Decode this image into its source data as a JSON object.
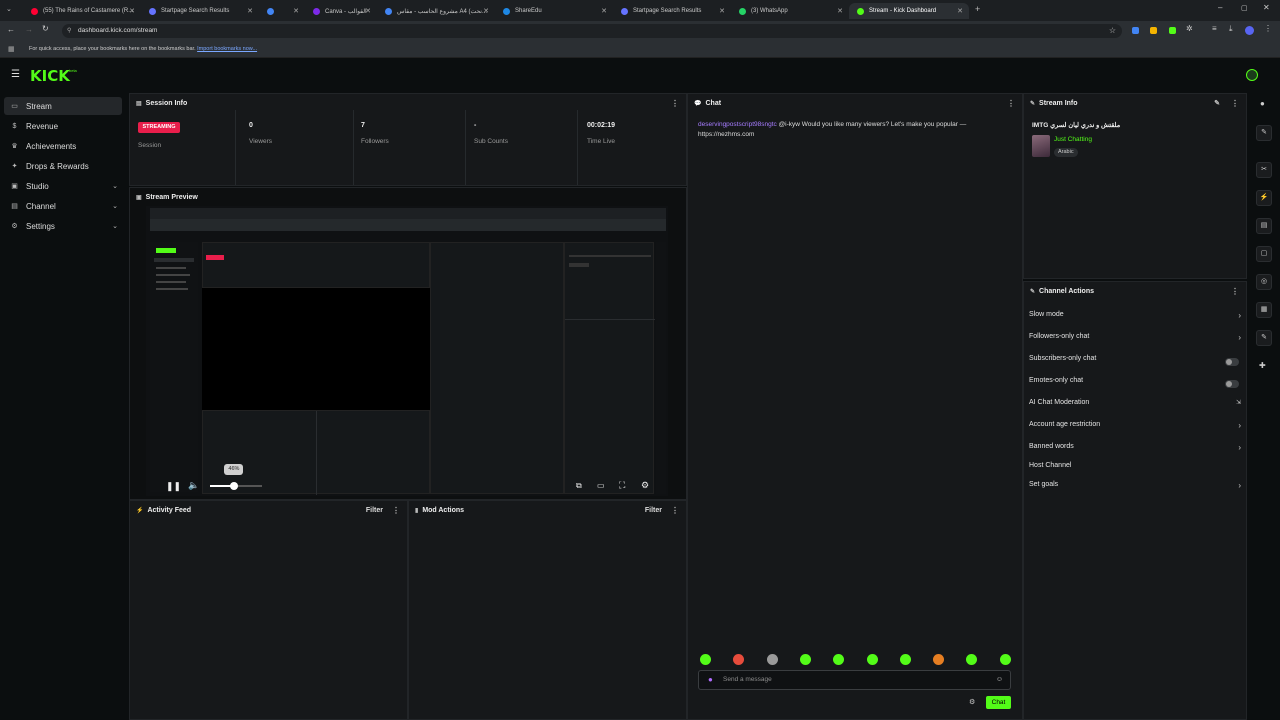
{
  "browser": {
    "tabs": [
      {
        "label": "(55) The Rains of Castamere (R...",
        "active": false,
        "color": "#ff0033"
      },
      {
        "label": "Startpage Search Results",
        "active": false,
        "color": "#6573ff"
      },
      {
        "label": "",
        "active": false,
        "color": "#4285f4"
      },
      {
        "label": "Canva - القوالب",
        "active": false,
        "color": "#7d2ae8"
      },
      {
        "label": "مشروع الحاسب - مقاس A4 (نحت...",
        "active": false,
        "color": "#4285f4"
      },
      {
        "label": "ShareEdu",
        "active": false,
        "color": "#1e88e5"
      },
      {
        "label": "Startpage Search Results",
        "active": false,
        "color": "#6573ff"
      },
      {
        "label": "(3) WhatsApp",
        "active": false,
        "color": "#25d366"
      },
      {
        "label": "Stream - Kick Dashboard",
        "active": true,
        "color": "#53fc18"
      }
    ],
    "url": "dashboard.kick.com/stream",
    "bookmarks_text": "For quick access, place your bookmarks here on the bookmarks bar.",
    "bookmarks_link": "Import bookmarks now..."
  },
  "app": {
    "logo": "KICK",
    "logo_badge": "beta"
  },
  "sidebar": {
    "items": [
      {
        "label": "Stream",
        "icon": "broadcast-icon",
        "glyph": "▭",
        "active": true,
        "chevron": false
      },
      {
        "label": "Revenue",
        "icon": "dollar-icon",
        "glyph": "$",
        "active": false,
        "chevron": false
      },
      {
        "label": "Achievements",
        "icon": "trophy-icon",
        "glyph": "♛",
        "active": false,
        "chevron": false
      },
      {
        "label": "Drops & Rewards",
        "icon": "gift-icon",
        "glyph": "✦",
        "active": false,
        "chevron": false
      },
      {
        "label": "Studio",
        "icon": "video-icon",
        "glyph": "▣",
        "active": false,
        "chevron": true
      },
      {
        "label": "Channel",
        "icon": "monitor-icon",
        "glyph": "▤",
        "active": false,
        "chevron": true
      },
      {
        "label": "Settings",
        "icon": "gear-icon",
        "glyph": "⚙",
        "active": false,
        "chevron": true
      }
    ]
  },
  "session": {
    "title": "Session Info",
    "badge": "STREAMING",
    "badge_caption": "Session",
    "stats": [
      {
        "value": "0",
        "label": "Viewers"
      },
      {
        "value": "7",
        "label": "Followers"
      },
      {
        "value": "-",
        "label": "Sub Counts"
      },
      {
        "value": "00:02:19",
        "label": "Time Live"
      }
    ]
  },
  "preview": {
    "title": "Stream Preview",
    "volume_tooltip": "46%",
    "volume": 0.46
  },
  "activity": {
    "title": "Activity Feed",
    "filter": "Filter"
  },
  "mod": {
    "title": "Mod Actions",
    "filter": "Filter"
  },
  "chat": {
    "title": "Chat",
    "message_user": "deservingpostscript98sngtc",
    "message_text": "@i-kyw Would you like many viewers? Let's make you popular — https://nezhms.com",
    "input_placeholder": "Send a message",
    "send_label": "Chat",
    "emote_colors": [
      "#53fc18",
      "#e74c3c",
      "#9a9a9a",
      "#53fc18",
      "#53fc18",
      "#53fc18",
      "#53fc18",
      "#e67e22",
      "#53fc18",
      "#53fc18"
    ]
  },
  "stream_info": {
    "title": "Stream Info",
    "stream_title": "IMTG ملقتش و ندري ليان لسري",
    "category": "Just Chatting",
    "tag": "Arabic"
  },
  "channel_actions": {
    "title": "Channel Actions",
    "items": [
      {
        "label": "Slow mode",
        "control": "chevron"
      },
      {
        "label": "Followers-only chat",
        "control": "chevron"
      },
      {
        "label": "Subscribers-only chat",
        "control": "toggle"
      },
      {
        "label": "Emotes-only chat",
        "control": "toggle"
      },
      {
        "label": "AI Chat Moderation",
        "control": "external"
      },
      {
        "label": "Account age restriction",
        "control": "chevron"
      },
      {
        "label": "Banned words",
        "control": "chevron"
      },
      {
        "label": "Host Channel",
        "control": "none"
      },
      {
        "label": "Set goals",
        "control": "chevron"
      }
    ]
  }
}
